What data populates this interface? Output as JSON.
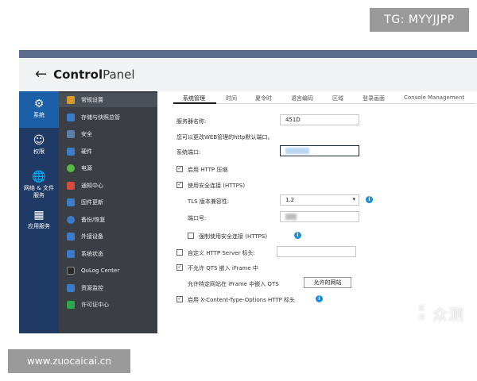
{
  "badges": {
    "tg": "TG: MYYJJPP",
    "url": "www.zuocaicai.cn"
  },
  "window": {
    "title_bold": "Control",
    "title_light": "Panel"
  },
  "iconbar": [
    {
      "label": "系统",
      "icon": "gear-icon"
    },
    {
      "label": "权限",
      "icon": "user-icon"
    },
    {
      "label": "网络 & 文件\n服务",
      "icon": "globe-icon"
    },
    {
      "label": "应用服务",
      "icon": "grid-icon"
    }
  ],
  "menu": [
    {
      "label": "常规设置",
      "color": "#d89a2a"
    },
    {
      "label": "存储与快照总管",
      "color": "#3b7bc8"
    },
    {
      "label": "安全",
      "color": "#5b7fa6"
    },
    {
      "label": "硬件",
      "color": "#3b7bc8"
    },
    {
      "label": "电源",
      "color": "#58b848"
    },
    {
      "label": "通知中心",
      "color": "#d84a3a"
    },
    {
      "label": "固件更新",
      "color": "#3b7bc8"
    },
    {
      "label": "备份/恢复",
      "color": "#3b7bc8"
    },
    {
      "label": "外接设备",
      "color": "#3b7bc8"
    },
    {
      "label": "系统状态",
      "color": "#3b7bc8"
    },
    {
      "label": "QuLog Center",
      "color": "#2a2a2a"
    },
    {
      "label": "资源监控",
      "color": "#3b7bc8"
    },
    {
      "label": "许可证中心",
      "color": "#2aa84a"
    }
  ],
  "tabs": [
    "系统管理",
    "时间",
    "夏令时",
    "语言编码",
    "区域",
    "登录画面",
    "Console Management"
  ],
  "form": {
    "server_name_label": "服务器名称:",
    "server_name_value": "451D",
    "hint": "您可以更改WEB管理的http默认端口。",
    "system_port_label": "系统端口:",
    "http_compress_label": "启用 HTTP 压缩",
    "https_label": "使用安全连接 (HTTPS)",
    "tls_label": "TLS 版本兼容性:",
    "tls_value": "1.2",
    "port_label": "端口号:",
    "force_https_label": "强制使用安全连接 (HTTPS)",
    "custom_header_label": "自定义 HTTP Server 标头:",
    "no_iframe_label": "不允许 QTS 嵌入 iFrame 中",
    "allow_sites_label": "允许特定网站在 iFrame 中嵌入 QTS",
    "allow_sites_button": "允许的网站",
    "xcontent_label": "启用 X-Content-Type-Options HTTP 标头"
  },
  "watermark": {
    "box": "新\n浪",
    "text": "众测"
  }
}
